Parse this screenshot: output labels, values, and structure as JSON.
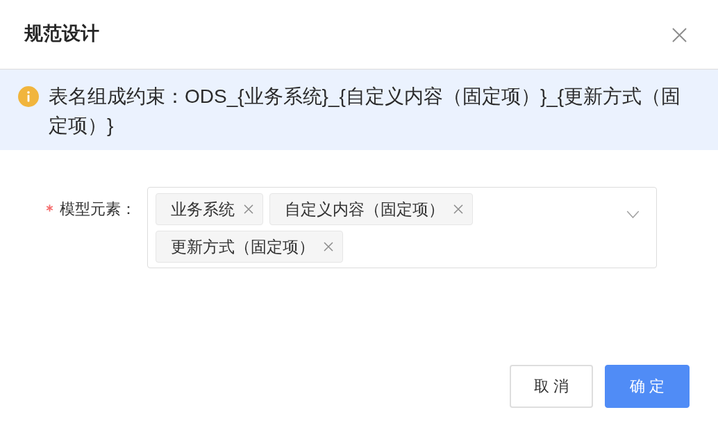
{
  "dialog": {
    "title": "规范设计"
  },
  "alert": {
    "kind": "info",
    "text": "表名组成约束：ODS_{业务系统}_{自定义内容（固定项）}_{更新方式（固定项）}"
  },
  "form": {
    "fields": [
      {
        "kind": "multiselect",
        "label": "模型元素：",
        "required": true,
        "tags": [
          "业务系统",
          "自定义内容（固定项）",
          "更新方式（固定项）"
        ]
      }
    ]
  },
  "buttons": [
    {
      "kind": "default",
      "label": "取 消"
    },
    {
      "kind": "primary",
      "label": "确 定"
    }
  ]
}
